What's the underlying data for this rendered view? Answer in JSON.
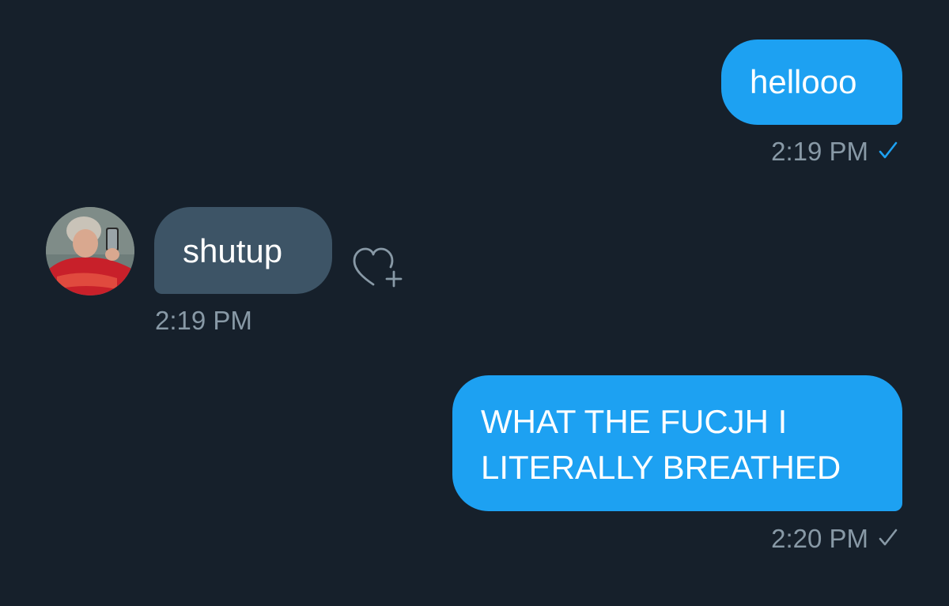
{
  "messages": [
    {
      "direction": "sent",
      "text": "hellooo",
      "time": "2:19 PM",
      "status": "read",
      "check_color": "#1da1f2"
    },
    {
      "direction": "received",
      "text": "shutup",
      "time": "2:19 PM"
    },
    {
      "direction": "sent",
      "lines": [
        "WHAT THE FUCJH I",
        "LITERALLY BREATHED"
      ],
      "time": "2:20 PM",
      "status": "sent",
      "check_color": "#8899a6"
    }
  ],
  "colors": {
    "background": "#16202b",
    "sent_bubble": "#1da1f2",
    "received_bubble": "#3d5466",
    "timestamp": "#8899a6"
  },
  "icons": {
    "avatar": "user-avatar-photo",
    "reaction": "heart-plus-icon",
    "read_receipt": "checkmark-icon"
  }
}
